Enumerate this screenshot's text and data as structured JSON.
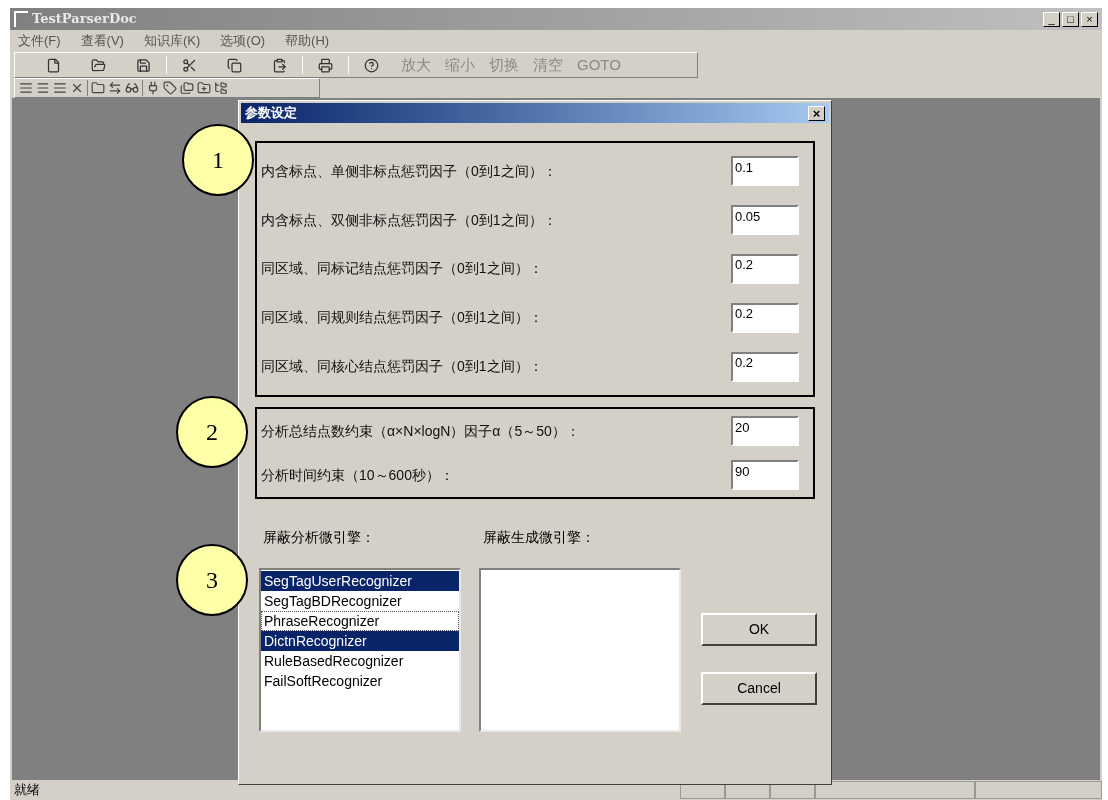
{
  "window": {
    "title": "TestParserDoc",
    "controls": [
      "_",
      "□",
      "×"
    ]
  },
  "menu": [
    "文件(F)",
    "查看(V)",
    "知识库(K)",
    "选项(O)",
    "帮助(H)"
  ],
  "toolbar_text_buttons": [
    {
      "label": "放大",
      "disabled": true
    },
    {
      "label": "缩小",
      "disabled": true
    },
    {
      "label": "切换",
      "disabled": true
    },
    {
      "label": "清空",
      "disabled": true
    },
    {
      "label": "GOTO",
      "disabled": true
    }
  ],
  "dialog": {
    "title": "参数设定",
    "close": "×",
    "groups": [
      {
        "fields": [
          {
            "label": "内含标点、单侧非标点惩罚因子（0到1之间）：",
            "value": "0.1"
          },
          {
            "label": "内含标点、双侧非标点惩罚因子（0到1之间）：",
            "value": "0.05"
          },
          {
            "label": "同区域、同标记结点惩罚因子（0到1之间）：",
            "value": "0.2"
          },
          {
            "label": "同区域、同规则结点惩罚因子（0到1之间）：",
            "value": "0.2"
          },
          {
            "label": "同区域、同核心结点惩罚因子（0到1之间）：",
            "value": "0.2"
          }
        ]
      },
      {
        "fields": [
          {
            "label": "分析总结点数约束（α×N×logN）因子α（5～50）：",
            "value": "20"
          },
          {
            "label": "分析时间约束（10～600秒）：",
            "value": "90"
          }
        ]
      }
    ],
    "lists": [
      {
        "label": "屏蔽分析微引擎：",
        "items": [
          {
            "text": "SegTagUserRecognizer",
            "selected": true,
            "focused": false
          },
          {
            "text": "SegTagBDRecognizer",
            "selected": false,
            "focused": false
          },
          {
            "text": "PhraseRecognizer",
            "selected": false,
            "focused": true
          },
          {
            "text": "DictnRecognizer",
            "selected": true,
            "focused": false
          },
          {
            "text": "RuleBasedRecognizer",
            "selected": false,
            "focused": false
          },
          {
            "text": "FailSoftRecognizer",
            "selected": false,
            "focused": false
          }
        ]
      },
      {
        "label": "屏蔽生成微引擎："
      }
    ],
    "buttons": [
      "OK",
      "Cancel"
    ]
  },
  "annotations": [
    "1",
    "2",
    "3"
  ],
  "status_bar": {
    "text": "就绪"
  }
}
